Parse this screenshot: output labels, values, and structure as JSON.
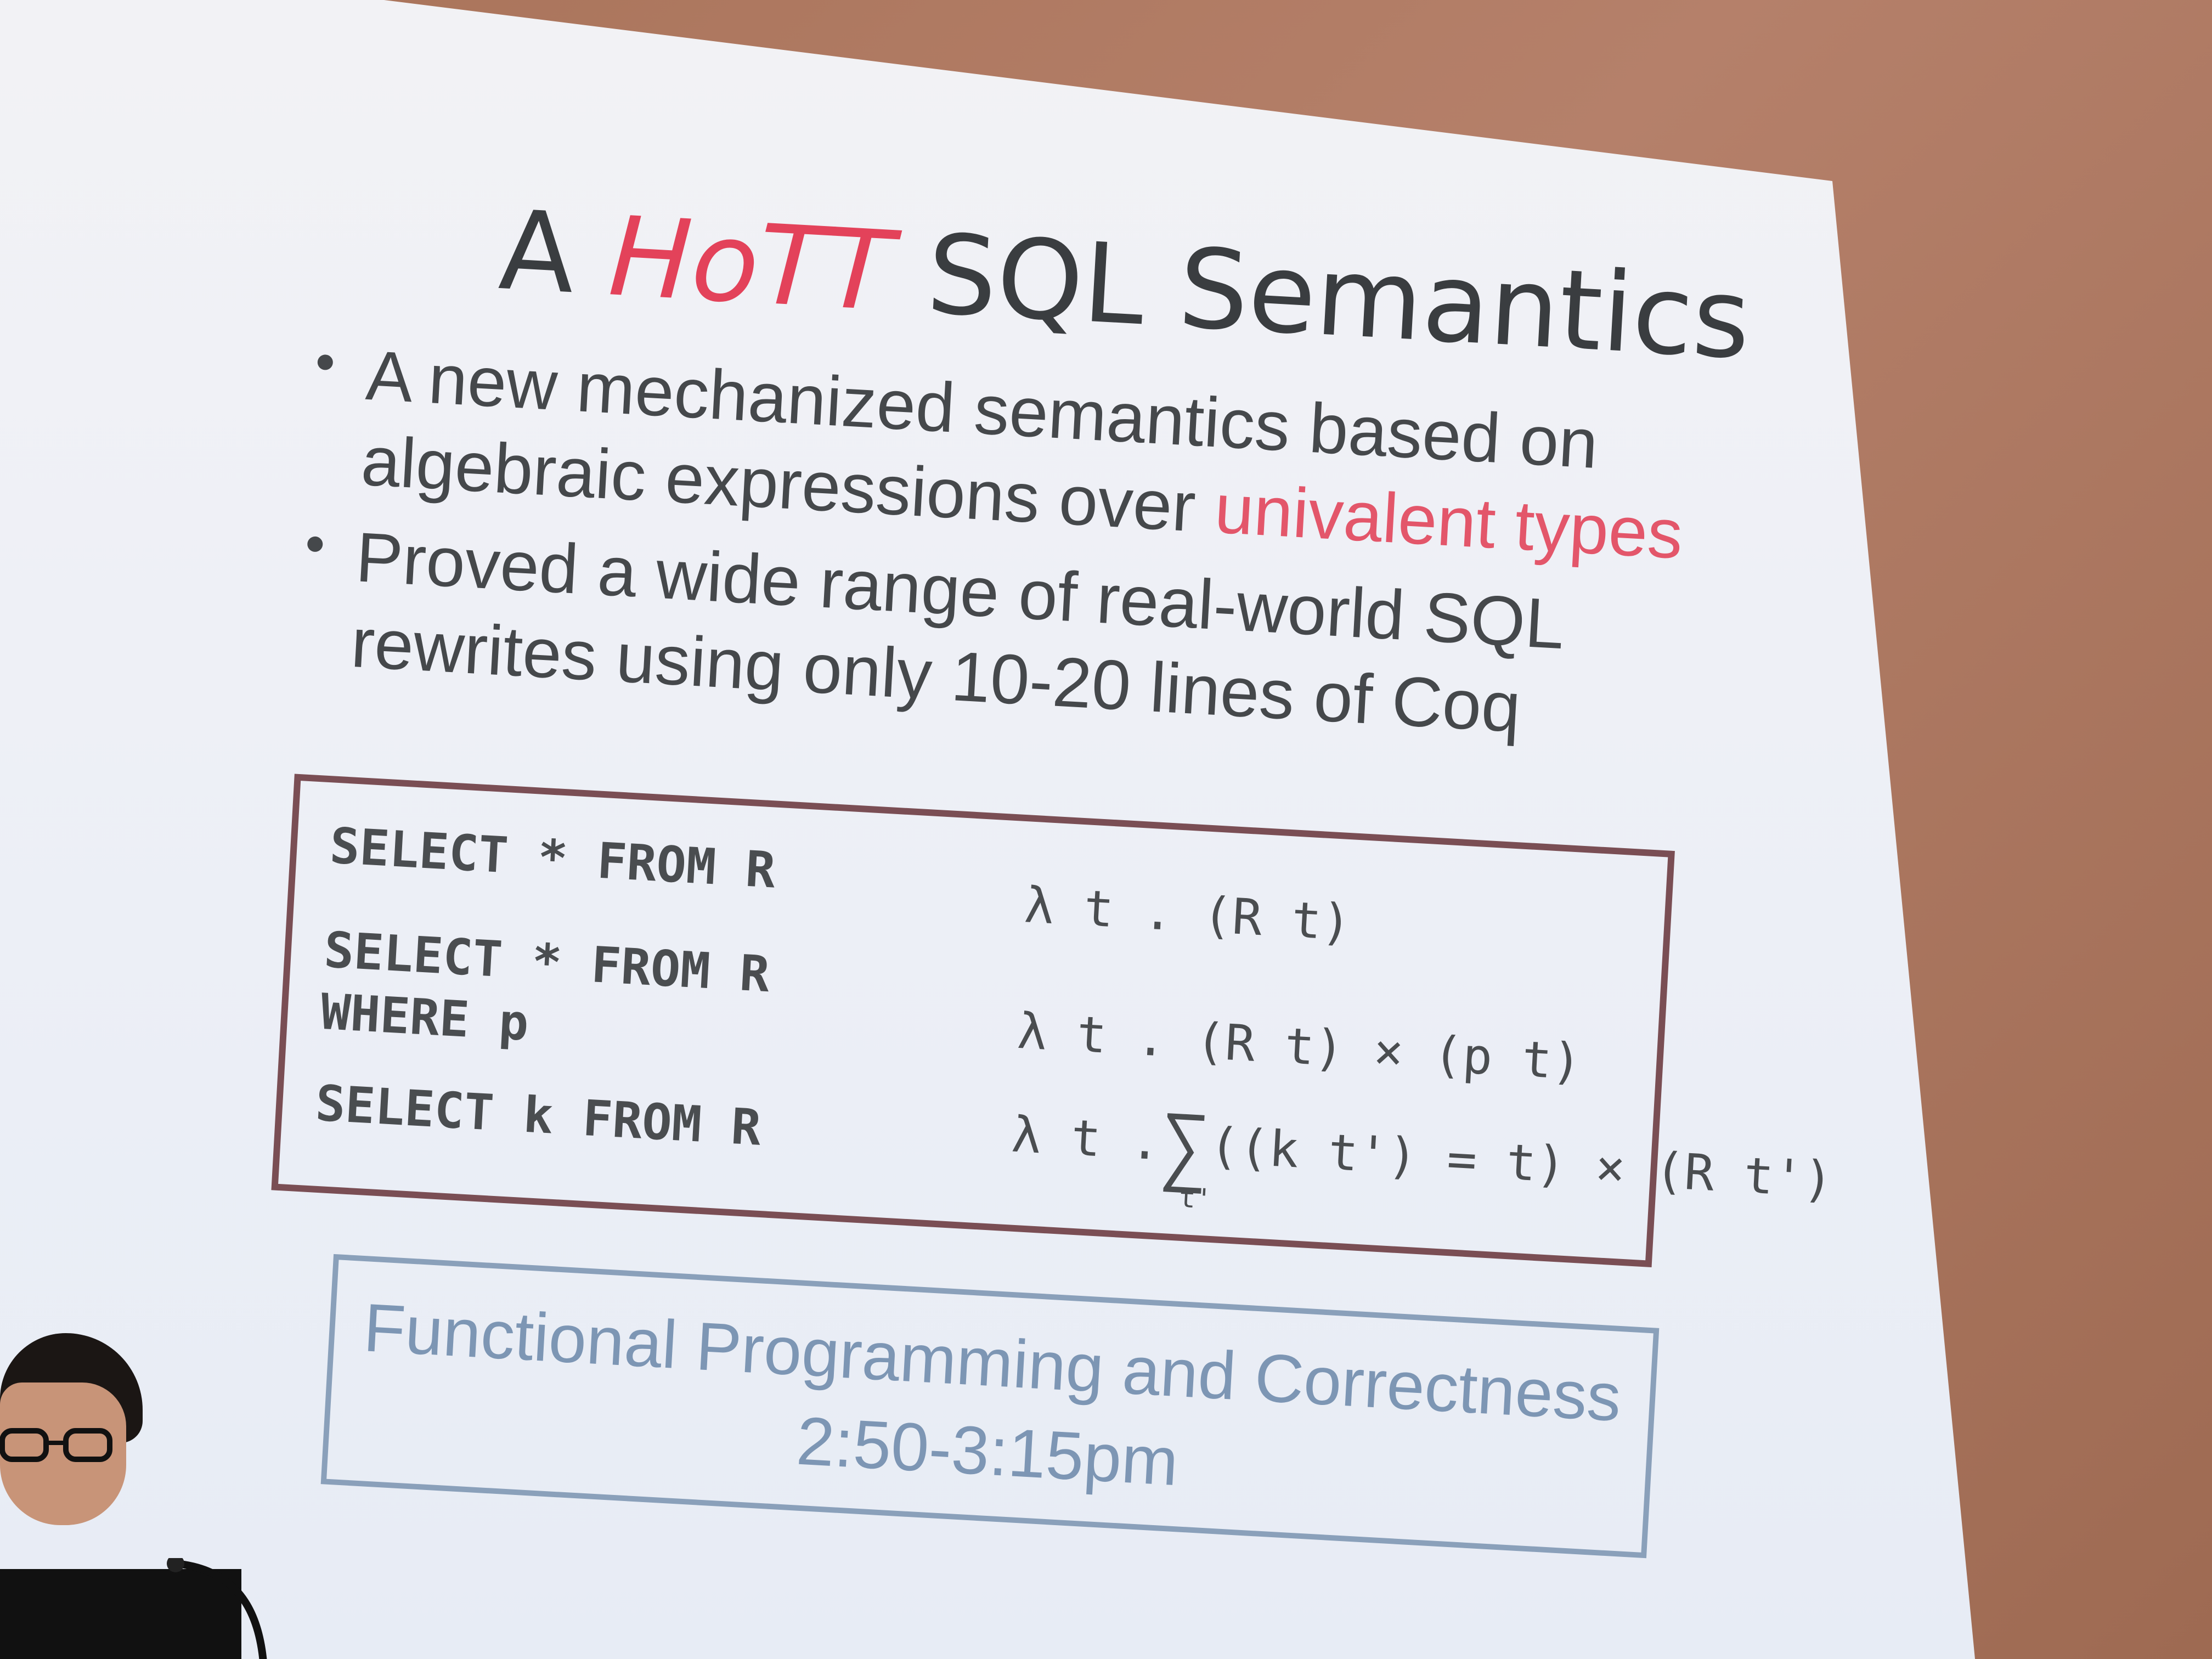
{
  "slide": {
    "title": {
      "prefix": "A ",
      "accent": "HoTT",
      "suffix": " SQL Semantics"
    },
    "bullets": [
      {
        "text": "A new mechanized semantics based on algebraic expressions over ",
        "highlight": "univalent types"
      },
      {
        "text": "Proved a wide range of real-world SQL rewrites using only 10-20 lines of Coq",
        "highlight": ""
      }
    ],
    "code_table": {
      "rows": [
        {
          "sql": "SELECT * FROM R",
          "expr": "λ t . (R t)"
        },
        {
          "sql": "SELECT * FROM R\nWHERE p",
          "expr": "λ t . (R t) × (p t)"
        },
        {
          "sql": "SELECT k FROM R",
          "expr_prefix": "λ t .",
          "expr_sigma": "∑",
          "expr_sigma_sub": "t'",
          "expr_body": "((k t') = t) × (R t')"
        }
      ]
    },
    "session": {
      "title": "Functional Programming and Correctness",
      "time": "2:50-3:15pm"
    },
    "colors": {
      "accent": "#e3425a",
      "text": "#45484b",
      "code_border": "#7a4e54",
      "session": "#7d96b4"
    }
  }
}
